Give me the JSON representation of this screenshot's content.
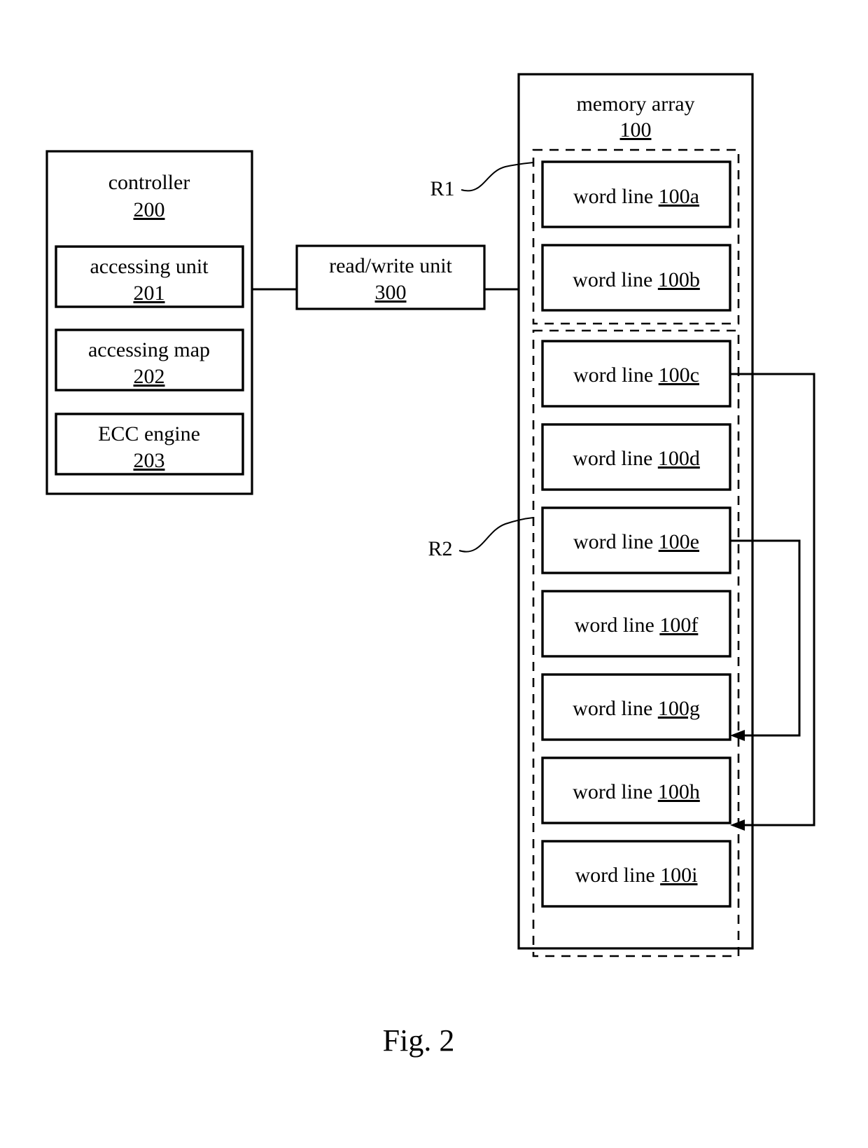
{
  "figure": {
    "caption": "Fig. 2",
    "accent_color": "#000000",
    "background_color": "#ffffff"
  },
  "controller": {
    "title": "controller",
    "ref": "200",
    "subblocks": [
      {
        "title": "accessing unit",
        "ref": "201"
      },
      {
        "title": "accessing map",
        "ref": "202"
      },
      {
        "title": "ECC engine",
        "ref": "203"
      }
    ]
  },
  "read_write_unit": {
    "title": "read/write unit",
    "ref": "300"
  },
  "memory_array": {
    "title": "memory array",
    "ref": "100",
    "regions": [
      {
        "label": "R1",
        "word_lines": [
          {
            "label": "word line",
            "ref": "100a"
          },
          {
            "label": "word line",
            "ref": "100b"
          }
        ]
      },
      {
        "label": "R2",
        "word_lines": [
          {
            "label": "word line",
            "ref": "100c"
          },
          {
            "label": "word line",
            "ref": "100d"
          },
          {
            "label": "word line",
            "ref": "100e"
          },
          {
            "label": "word line",
            "ref": "100f"
          },
          {
            "label": "word line",
            "ref": "100g"
          },
          {
            "label": "word line",
            "ref": "100h"
          },
          {
            "label": "word line",
            "ref": "100i"
          }
        ]
      }
    ]
  },
  "chart_data": {
    "type": "diagram",
    "title": "Fig. 2",
    "nodes": [
      {
        "id": "200",
        "label": "controller",
        "ref": "200"
      },
      {
        "id": "201",
        "label": "accessing unit",
        "ref": "201",
        "parent": "200"
      },
      {
        "id": "202",
        "label": "accessing map",
        "ref": "202",
        "parent": "200"
      },
      {
        "id": "203",
        "label": "ECC engine",
        "ref": "203",
        "parent": "200"
      },
      {
        "id": "300",
        "label": "read/write unit",
        "ref": "300"
      },
      {
        "id": "100",
        "label": "memory array",
        "ref": "100"
      },
      {
        "id": "100a",
        "label": "word line 100a",
        "ref": "100a",
        "region": "R1"
      },
      {
        "id": "100b",
        "label": "word line 100b",
        "ref": "100b",
        "region": "R1"
      },
      {
        "id": "100c",
        "label": "word line 100c",
        "ref": "100c",
        "region": "R2"
      },
      {
        "id": "100d",
        "label": "word line 100d",
        "ref": "100d",
        "region": "R2"
      },
      {
        "id": "100e",
        "label": "word line 100e",
        "ref": "100e",
        "region": "R2"
      },
      {
        "id": "100f",
        "label": "word line 100f",
        "ref": "100f",
        "region": "R2"
      },
      {
        "id": "100g",
        "label": "word line 100g",
        "ref": "100g",
        "region": "R2"
      },
      {
        "id": "100h",
        "label": "word line 100h",
        "ref": "100h",
        "region": "R2"
      },
      {
        "id": "100i",
        "label": "word line 100i",
        "ref": "100i",
        "region": "R2"
      }
    ],
    "edges": [
      {
        "from": "200",
        "to": "300",
        "style": "plain"
      },
      {
        "from": "300",
        "to": "100",
        "style": "plain"
      },
      {
        "from": "100c",
        "to": "100h",
        "style": "arrow"
      },
      {
        "from": "100e",
        "to": "100g",
        "style": "arrow"
      }
    ],
    "regions": [
      {
        "label": "R1",
        "members": [
          "100a",
          "100b"
        ]
      },
      {
        "label": "R2",
        "members": [
          "100c",
          "100d",
          "100e",
          "100f",
          "100g",
          "100h",
          "100i"
        ]
      }
    ]
  }
}
